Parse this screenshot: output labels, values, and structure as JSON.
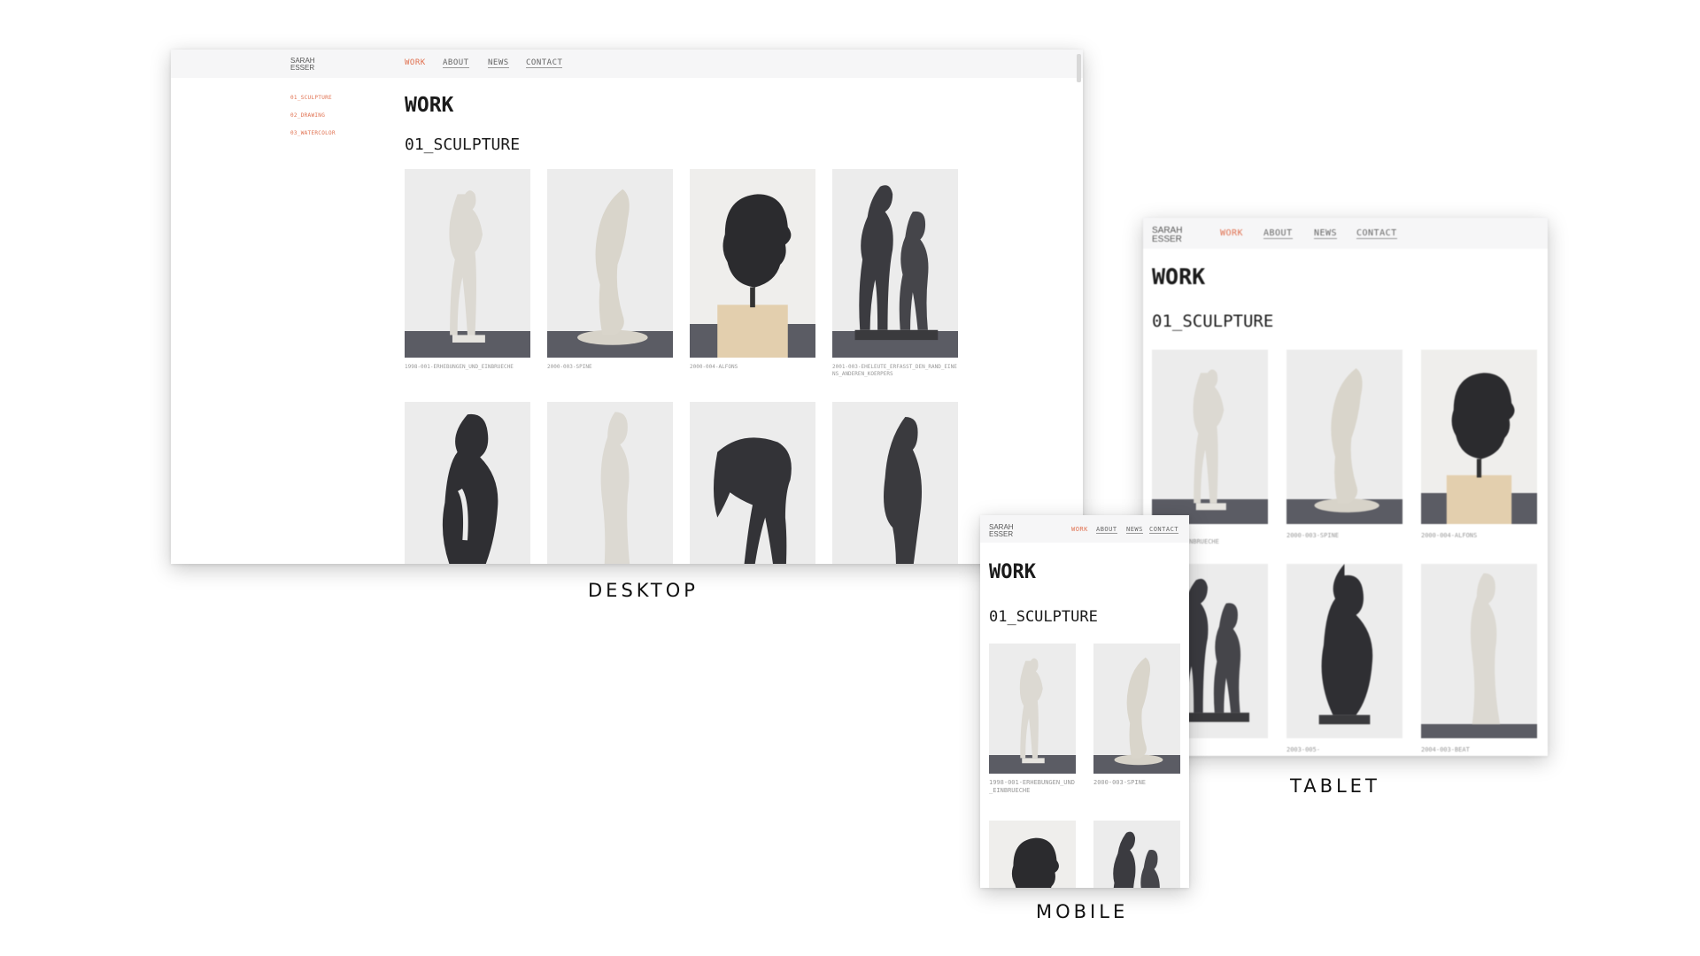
{
  "labels": {
    "desktop": "DESKTOP",
    "tablet": "TABLET",
    "mobile": "MOBILE"
  },
  "site": {
    "brand": "SARAH\nESSER",
    "nav": [
      "WORK",
      "ABOUT",
      "NEWS",
      "CONTACT"
    ],
    "active_nav": "WORK",
    "sidebar": [
      "01_SCULPTURE",
      "02_DRAWING",
      "03_WATERCOLOR"
    ],
    "page_title": "WORK",
    "section_title": "01_SCULPTURE"
  },
  "works": [
    {
      "caption": "1998-001-ERHEBUNGEN_UND_EINBRUECHE"
    },
    {
      "caption": "2000-003-SPINE"
    },
    {
      "caption": "2000-004-ALFONS"
    },
    {
      "caption": "2001-003-EHELEUTE_ERFASST_DEN_RAND_EINENS_ANDEREN_KOERPERS"
    },
    {
      "caption": ""
    },
    {
      "caption": ""
    },
    {
      "caption": ""
    },
    {
      "caption": ""
    }
  ],
  "tablet_captions": [
    "…EN_UND_EINBRUECHE",
    "2000-003-SPINE",
    "2000-004-ALFONS",
    "",
    "2003-005-",
    "2004-003-BEAT"
  ],
  "mobile_captions": [
    "1998-001-ERHEBUNGEN_UND_EINBRUECHE",
    "2000-003-SPINE"
  ],
  "colors": {
    "accent": "#e0704f",
    "bar": "#f6f6f7",
    "text": "#1b1b1b",
    "caption": "#999999"
  }
}
